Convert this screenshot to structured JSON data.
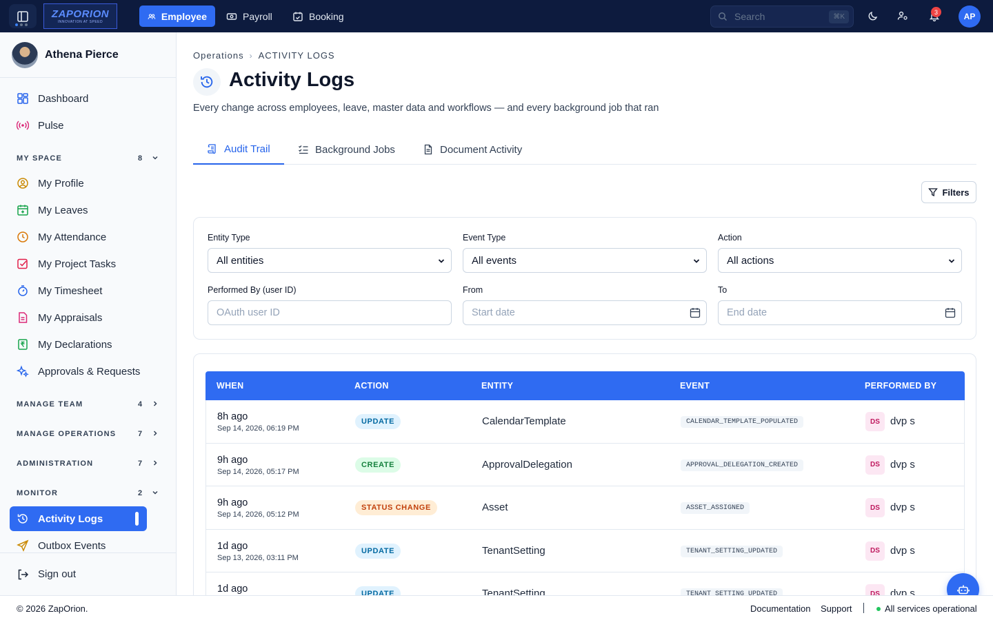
{
  "topbar": {
    "logo_text": "ZAPORION",
    "logo_tagline": "INNOVATION AT SPEED",
    "tabs": [
      {
        "label": "Employee"
      },
      {
        "label": "Payroll"
      },
      {
        "label": "Booking"
      }
    ],
    "search": {
      "placeholder": "Search",
      "shortcut": "⌘K"
    },
    "notification_count": "3",
    "user_initials": "AP",
    "accent_color": "#2f6bf2",
    "bar_color": "#0d1b3e"
  },
  "sidebar": {
    "user_name": "Athena Pierce",
    "top_items": [
      {
        "label": "Dashboard",
        "icon": "dashboard-icon"
      },
      {
        "label": "Pulse",
        "icon": "pulse-icon"
      }
    ],
    "sections": {
      "my_space": {
        "title": "MY SPACE",
        "count": "8"
      },
      "manage_team": {
        "title": "MANAGE TEAM",
        "count": "4"
      },
      "manage_operations": {
        "title": "MANAGE OPERATIONS",
        "count": "7"
      },
      "administration": {
        "title": "ADMINISTRATION",
        "count": "7"
      },
      "monitor": {
        "title": "MONITOR",
        "count": "2"
      }
    },
    "my_space_items": [
      {
        "label": "My Profile",
        "icon": "user-circle-icon"
      },
      {
        "label": "My Leaves",
        "icon": "calendar-plus-icon"
      },
      {
        "label": "My Attendance",
        "icon": "clock-icon"
      },
      {
        "label": "My Project Tasks",
        "icon": "checkbox-icon"
      },
      {
        "label": "My Timesheet",
        "icon": "stopwatch-icon"
      },
      {
        "label": "My Appraisals",
        "icon": "document-icon"
      },
      {
        "label": "My Declarations",
        "icon": "rupee-icon"
      },
      {
        "label": "Approvals & Requests",
        "icon": "sparkle-icon"
      }
    ],
    "monitor_items": [
      {
        "label": "Activity Logs",
        "icon": "history-icon"
      },
      {
        "label": "Outbox Events",
        "icon": "send-icon"
      }
    ],
    "sign_out": "Sign out"
  },
  "page": {
    "breadcrumb": {
      "parent": "Operations",
      "current": "ACTIVITY LOGS"
    },
    "title": "Activity Logs",
    "subtitle": "Every change across employees, leave, master data and workflows — and every background job that ran",
    "tabs": [
      {
        "label": "Audit Trail"
      },
      {
        "label": "Background Jobs"
      },
      {
        "label": "Document Activity"
      }
    ],
    "filters_button": "Filters"
  },
  "filters": {
    "entity_type": {
      "label": "Entity Type",
      "value": "All entities"
    },
    "event_type": {
      "label": "Event Type",
      "value": "All events"
    },
    "action": {
      "label": "Action",
      "value": "All actions"
    },
    "performed_by": {
      "label": "Performed By (user ID)",
      "placeholder": "OAuth user ID"
    },
    "from": {
      "label": "From",
      "placeholder": "Start date"
    },
    "to": {
      "label": "To",
      "placeholder": "End date"
    }
  },
  "table": {
    "columns": [
      "WHEN",
      "ACTION",
      "ENTITY",
      "EVENT",
      "PERFORMED BY"
    ],
    "rows": [
      {
        "when_relative": "8h ago",
        "when_absolute": "Sep 14, 2026, 06:19 PM",
        "action": "UPDATE",
        "entity": "CalendarTemplate",
        "event": "CALENDAR_TEMPLATE_POPULATED",
        "initials": "DS",
        "performer": "dvp s"
      },
      {
        "when_relative": "9h ago",
        "when_absolute": "Sep 14, 2026, 05:17 PM",
        "action": "CREATE",
        "entity": "ApprovalDelegation",
        "event": "APPROVAL_DELEGATION_CREATED",
        "initials": "DS",
        "performer": "dvp s"
      },
      {
        "when_relative": "9h ago",
        "when_absolute": "Sep 14, 2026, 05:12 PM",
        "action": "STATUS CHANGE",
        "entity": "Asset",
        "event": "ASSET_ASSIGNED",
        "initials": "DS",
        "performer": "dvp s"
      },
      {
        "when_relative": "1d ago",
        "when_absolute": "Sep 13, 2026, 03:11 PM",
        "action": "UPDATE",
        "entity": "TenantSetting",
        "event": "TENANT_SETTING_UPDATED",
        "initials": "DS",
        "performer": "dvp s"
      },
      {
        "when_relative": "1d ago",
        "when_absolute": "",
        "action": "UPDATE",
        "entity": "TenantSetting",
        "event": "TENANT_SETTING_UPDATED",
        "initials": "DS",
        "performer": "dvp s"
      }
    ]
  },
  "footer": {
    "copyright": "© 2026 ZapOrion.",
    "documentation": "Documentation",
    "support": "Support",
    "status": "All services operational"
  }
}
